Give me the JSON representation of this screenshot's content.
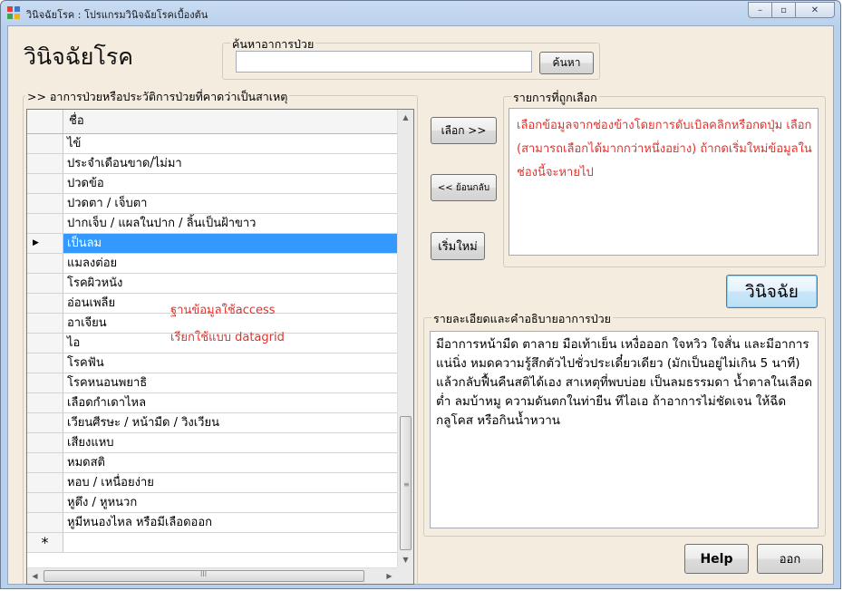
{
  "window": {
    "title": "วินิจฉัยโรค : โปรแกรมวินิจฉัยโรคเบื้องต้น",
    "minimize_glyph": "–",
    "maximize_glyph": "▫",
    "close_glyph": "✕"
  },
  "header": {
    "app_title": "วินิจฉัยโรค"
  },
  "search": {
    "legend": "ค้นหาอาการป่วย",
    "value": "",
    "placeholder": "",
    "button_label": "ค้นหา"
  },
  "symptoms": {
    "legend": ">> อาการป่วยหรือประวัติการป่วยที่คาดว่าเป็นสาเหตุ",
    "column_header": "ชื่อ",
    "selected_marker": "▶",
    "new_row_marker": "*",
    "rows": [
      "ไข้",
      "ประจำเดือนขาด/ไม่มา",
      "ปวดข้อ",
      "ปวดตา / เจ็บตา",
      "ปากเจ็บ / แผลในปาก / ลิ้นเป็นฝ้าขาว",
      "เป็นลม",
      "แมลงต่อย",
      "โรคผิวหนัง",
      "อ่อนเพลีย",
      "อาเจียน",
      "ไอ",
      "โรคฟัน",
      "โรคหนอนพยาธิ",
      "เลือดกำเดาไหล",
      "เวียนศีรษะ / หน้ามืด / วิงเวียน",
      "เสียงแหบ",
      "หมดสติ",
      "หอบ / เหนื่อยง่าย",
      "หูตึง / หูหนวก",
      "หูมีหนองไหล หรือมีเลือดออก"
    ],
    "selected_index": 5,
    "annotation_line1": "ฐานข้อมูลใช้access",
    "annotation_line2": "เรียกใช้แบบ datagrid"
  },
  "buttons": {
    "select": "เลือก >>",
    "back": "<< ย้อนกลับ",
    "reset": "เริ่มใหม่",
    "diagnose": "วินิจฉัย",
    "help": "Help",
    "exit": "ออก"
  },
  "selected_items": {
    "legend": "รายการที่ถูกเลือก",
    "hint": "เลือกข้อมูลจากช่องข้างโดยการดับเบิลคลิกหรือกดปุ่ม เลือก (สามารถเลือกได้มากกว่าหนึ่งอย่าง) ถ้ากดเริ่มใหม่ข้อมูลในช่องนี้จะหายไป"
  },
  "details": {
    "legend": "รายละเอียดและคำอธิบายอาการป่วย",
    "text": "มีอาการหน้ามืด ตาลาย มือเท้าเย็น เหงื่อออก ใจหวิว ใจสั่น และมีอาการแน่นิ่ง หมดความรู้สึกตัวไปชั่วประเดี๋ยวเดียว (มักเป็นอยู่ไม่เกิน 5 นาที) แล้วกลับฟื้นคืนสติได้เอง สาเหตุที่พบบ่อย เป็นลมธรรมดา น้ำตาลในเลือดต่ำ ลมบ้าหมู ความดันตกในท่ายืน ทีไอเอ ถ้าอาการไม่ชัดเจน ให้ฉีดกลูโคส หรือกินน้ำหวาน"
  },
  "scroll": {
    "grip": "≡",
    "grip_h": "III",
    "up": "▲",
    "down": "▼",
    "left": "◀",
    "right": "▶"
  },
  "colors": {
    "selected_row": "#3399ff",
    "annotation": "#e8302a",
    "client_bg": "#f4ecdf",
    "frame": "#b9d0ec"
  }
}
